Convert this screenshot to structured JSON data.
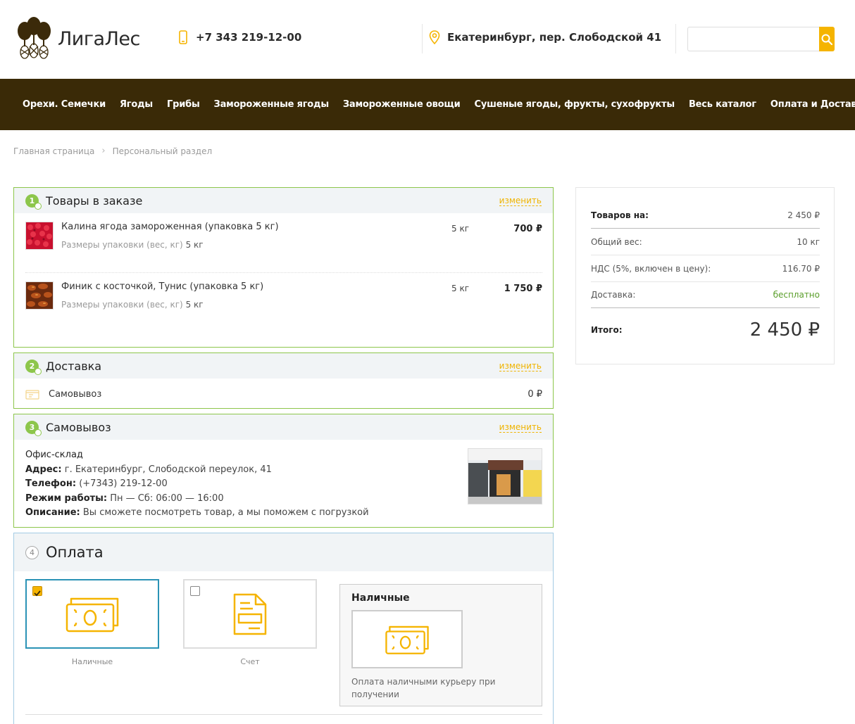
{
  "header": {
    "logo_text": "ЛигаЛес",
    "phone": "+7 343 219-12-00",
    "address": "Екатеринбург, пер. Слободской 41",
    "search": {
      "placeholder": ""
    }
  },
  "nav": {
    "items": [
      "Орехи. Семечки",
      "Ягоды",
      "Грибы",
      "Замороженные ягоды",
      "Замороженные овощи",
      "Сушеные ягоды, фрукты, сухофрукты",
      "Весь каталог",
      "Оплата и Доставка"
    ]
  },
  "breadcrumbs": [
    "Главная страница",
    "Персональный раздел"
  ],
  "colors": {
    "accent": "#f5b400",
    "nav_bg": "#3a2a07",
    "ok_green": "#8dc64b",
    "active_blue": "#2b93b6"
  },
  "order_items": {
    "step": "1",
    "title": "Товары в заказе",
    "change": "изменить",
    "items": [
      {
        "name": "Калина ягода замороженная (упаковка 5 кг)",
        "prop_label": "Размеры упаковки (вес, кг)",
        "prop_value": "5 кг",
        "qty": "5 кг",
        "price": "700 ₽"
      },
      {
        "name": "Финик с косточкой, Тунис (упаковка 5 кг)",
        "prop_label": "Размеры упаковки (вес, кг)",
        "prop_value": "5 кг",
        "qty": "5 кг",
        "price": "1 750 ₽"
      }
    ]
  },
  "delivery": {
    "step": "2",
    "title": "Доставка",
    "change": "изменить",
    "method": "Самовывоз",
    "price": "0 ₽"
  },
  "pickup": {
    "step": "3",
    "title": "Самовывоз",
    "change": "изменить",
    "name": "Офис-склад",
    "address_label": "Адрес:",
    "address": "г. Екатеринбург, Слободской переулок, 41",
    "phone_label": "Телефон:",
    "phone": "(+7343) 219-12-00",
    "hours_label": "Режим работы:",
    "hours": "Пн — Сб: 06:00 — 16:00",
    "desc_label": "Описание:",
    "desc": "Вы сможете посмотреть товар, а мы поможем с погрузкой"
  },
  "payment": {
    "step": "4",
    "title": "Оплата",
    "options": [
      {
        "label": "Наличные",
        "checked": true,
        "icon": "cash-icon"
      },
      {
        "label": "Счет",
        "checked": false,
        "icon": "invoice-icon"
      }
    ],
    "selected_title": "Наличные",
    "selected_desc": "Оплата наличными курьеру при получении"
  },
  "summary": {
    "goods_label": "Товаров на:",
    "goods_value": "2 450 ₽",
    "weight_label": "Общий вес:",
    "weight_value": "10 кг",
    "vat_label": "НДС (5%, включен в цену):",
    "vat_value": "116.70 ₽",
    "delivery_label": "Доставка:",
    "delivery_value": "бесплатно",
    "total_label": "Итого:",
    "total_value": "2 450 ₽"
  }
}
